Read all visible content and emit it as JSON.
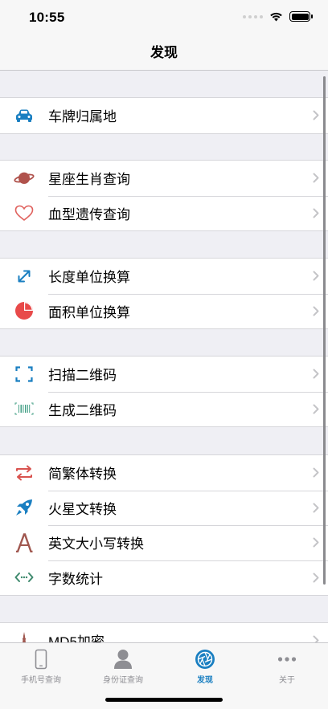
{
  "status": {
    "time": "10:55"
  },
  "nav": {
    "title": "发现"
  },
  "groups": [
    {
      "items": [
        {
          "label": "车牌归属地",
          "icon": "car-icon"
        }
      ]
    },
    {
      "items": [
        {
          "label": "星座生肖查询",
          "icon": "planet-icon"
        },
        {
          "label": "血型遗传查询",
          "icon": "heart-icon"
        }
      ]
    },
    {
      "items": [
        {
          "label": "长度单位换算",
          "icon": "resize-arrow-icon"
        },
        {
          "label": "面积单位换算",
          "icon": "pie-chart-icon"
        }
      ]
    },
    {
      "items": [
        {
          "label": "扫描二维码",
          "icon": "scan-icon"
        },
        {
          "label": "生成二维码",
          "icon": "barcode-icon"
        }
      ]
    },
    {
      "items": [
        {
          "label": "简繁体转换",
          "icon": "swap-arrows-icon"
        },
        {
          "label": "火星文转换",
          "icon": "rocket-icon"
        },
        {
          "label": "英文大小写转换",
          "icon": "letter-a-icon"
        },
        {
          "label": "字数统计",
          "icon": "code-icon"
        }
      ]
    },
    {
      "items": [
        {
          "label": "MD5加密",
          "icon": "tower-icon"
        }
      ]
    }
  ],
  "tabs": [
    {
      "label": "手机号查询",
      "icon": "phone-icon",
      "active": false
    },
    {
      "label": "身份证查询",
      "icon": "person-icon",
      "active": false
    },
    {
      "label": "发现",
      "icon": "aperture-icon",
      "active": true
    },
    {
      "label": "关于",
      "icon": "more-icon",
      "active": false
    }
  ],
  "colors": {
    "accent": "#1a7fc1",
    "background": "#efeff4",
    "tab_inactive": "#8e8e93"
  }
}
